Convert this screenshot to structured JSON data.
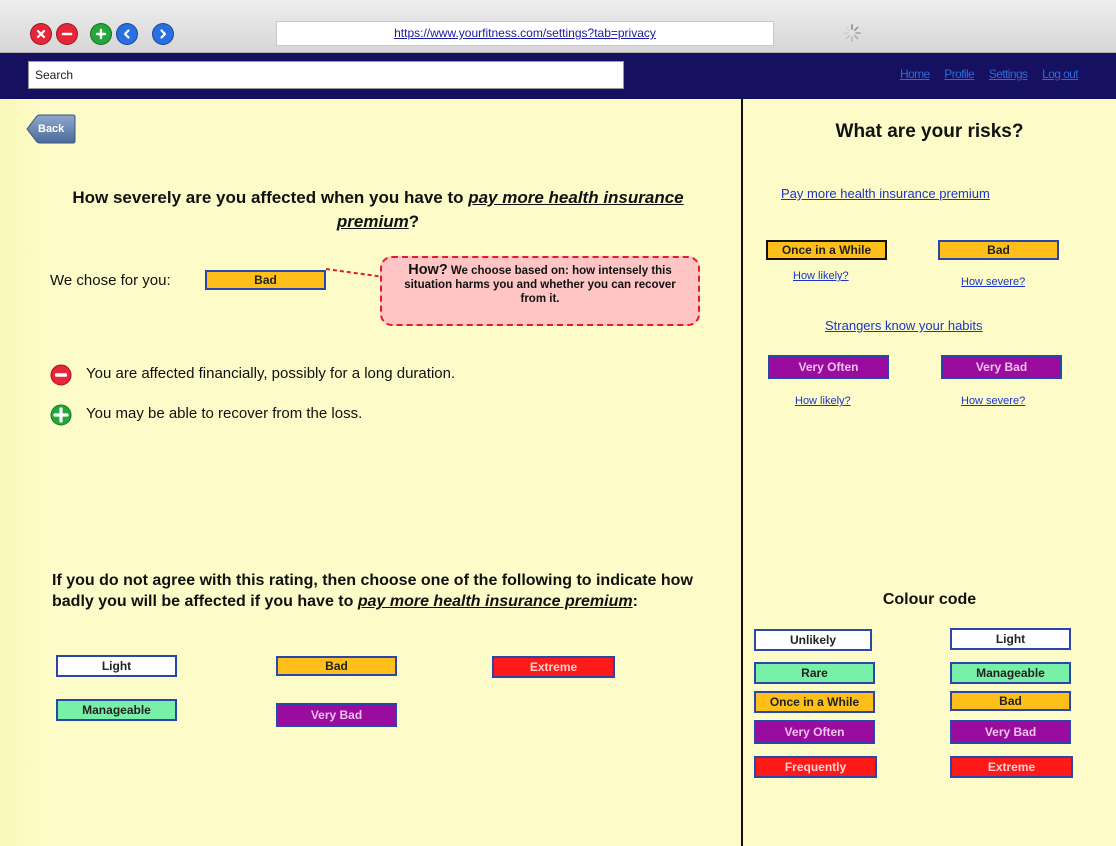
{
  "browser": {
    "url": "https://www.yourfitness.com/settings?tab=privacy",
    "buttons": [
      {
        "name": "close-window-icon",
        "color": "#e8263a"
      },
      {
        "name": "minimize-window-icon",
        "color": "#e8263a"
      },
      {
        "name": "add-window-icon",
        "color": "#22a83a"
      },
      {
        "name": "back-arrow-icon",
        "color": "#2a6fe0"
      },
      {
        "name": "forward-arrow-icon",
        "color": "#2a6fe0"
      }
    ]
  },
  "nav": {
    "search_placeholder": "Search",
    "links": {
      "home": "Home",
      "profile": "Profile",
      "settings": "Settings",
      "logout": "Log out"
    }
  },
  "main": {
    "back_label": "Back",
    "question": {
      "prefix": "How severely are you affected when you have to ",
      "emphasis": "pay more health insurance premium",
      "suffix": "?"
    },
    "chose_label": "We chose for you:",
    "chosen_value": "Bad",
    "callout": {
      "heading": "How?",
      "text": " We choose based on: how intensely this situation harms you and whether you can recover from it."
    },
    "points": [
      {
        "type": "negative",
        "text": "You are affected financially, possibly for a long duration."
      },
      {
        "type": "positive",
        "text": "You may be able to recover from the loss."
      }
    ],
    "disagree": {
      "prefix": "If you do not agree with this rating, then choose one of the following to indicate how badly you will be affected if you have to ",
      "emphasis": "pay more health insurance premium",
      "suffix": ":"
    },
    "options": {
      "light": "Light",
      "bad": "Bad",
      "extreme": "Extreme",
      "manageable": "Manageable",
      "very_bad": "Very Bad"
    }
  },
  "sidebar": {
    "title": "What are your risks?",
    "risks": [
      {
        "name": "Pay more health insurance premium",
        "likelihood": "Once in a While",
        "severity": "Bad",
        "likely_link": "How likely?",
        "severe_link": "How severe?"
      },
      {
        "name": "Strangers know your habits",
        "likelihood": "Very Often",
        "severity": "Very Bad",
        "likely_link": "How likely?",
        "severe_link": "How severe?"
      }
    ],
    "colour_code": {
      "title": "Colour code",
      "likelihood": [
        "Unlikely",
        "Rare",
        "Once in a While",
        "Very Often",
        "Frequently"
      ],
      "severity": [
        "Light",
        "Manageable",
        "Bad",
        "Very Bad",
        "Extreme"
      ]
    }
  },
  "colors": {
    "background": "#fdfcc8",
    "navbar": "#15105f",
    "bad": "#ffbf1a",
    "manageable": "#78f0a8",
    "very_bad": "#9a0c9e",
    "extreme": "#ff1a1a",
    "light": "#ffffff"
  }
}
